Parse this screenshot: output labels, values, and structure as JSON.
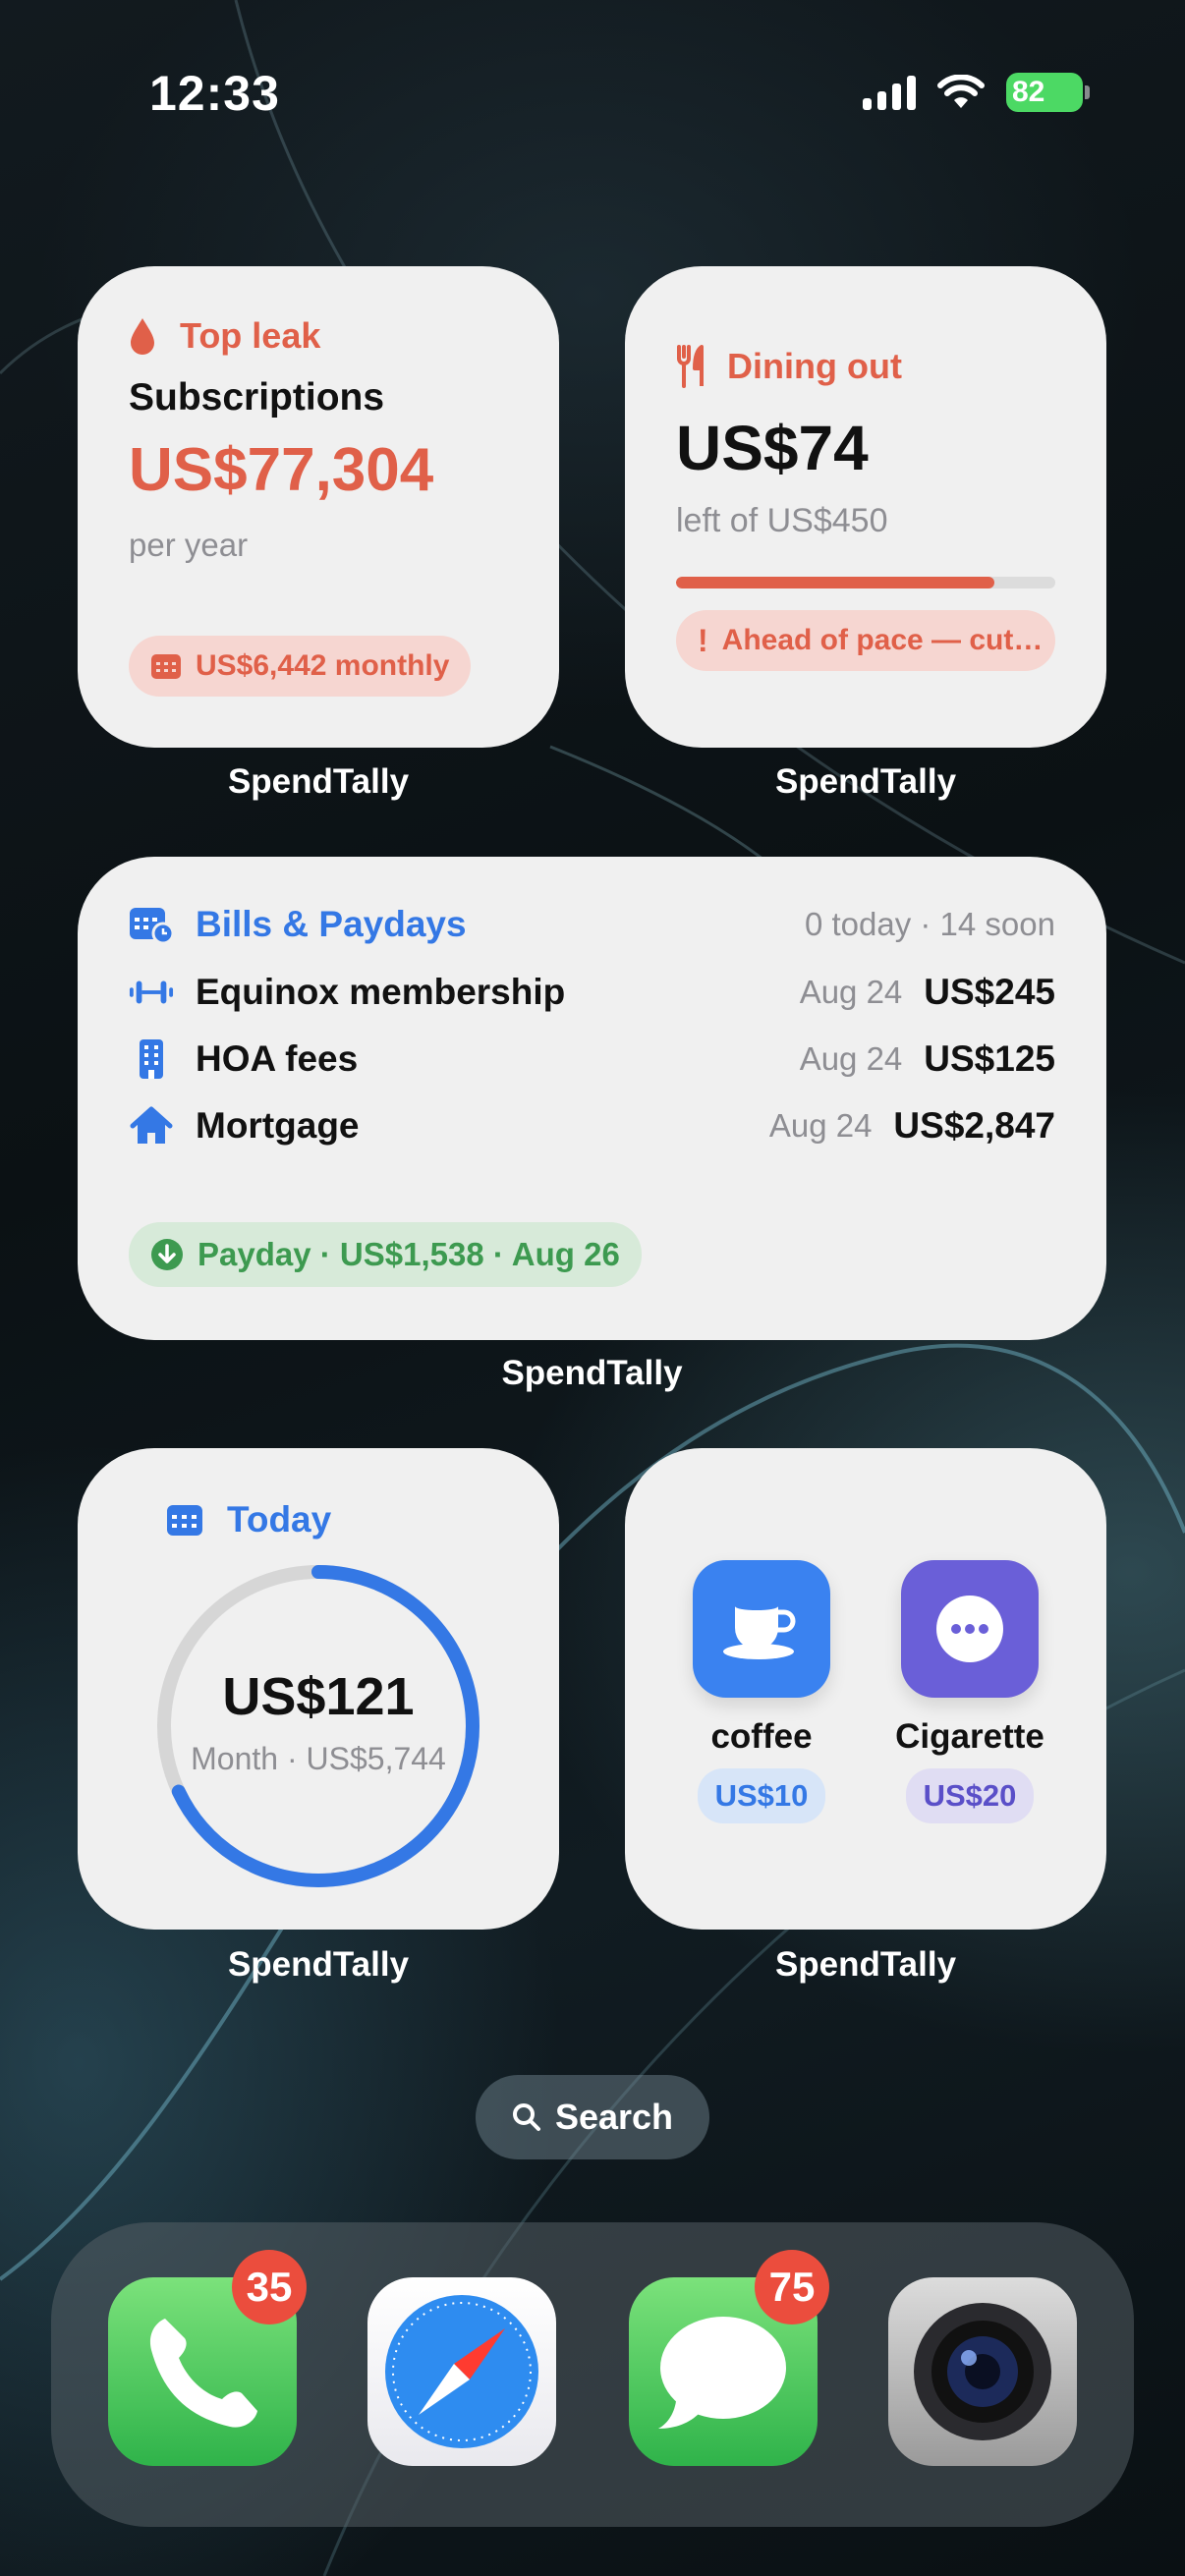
{
  "status_bar": {
    "time": "12:33",
    "battery": "82"
  },
  "widgets": {
    "top_leak": {
      "label": "Top leak",
      "category": "Subscriptions",
      "amount": "US$77,304",
      "period": "per year",
      "monthly": "US$6,442 monthly",
      "caption": "SpendTally",
      "accent": "#e06049"
    },
    "dining": {
      "label": "Dining out",
      "amount": "US$74",
      "remaining_text": "left of US$450",
      "progress": 0.84,
      "warning": "Ahead of pace — cut…",
      "caption": "SpendTally"
    },
    "bills": {
      "title": "Bills & Paydays",
      "summary": "0 today · 14 soon",
      "items": [
        {
          "name": "Equinox membership",
          "date": "Aug 24",
          "amount": "US$245",
          "icon": "dumbbell-icon"
        },
        {
          "name": "HOA fees",
          "date": "Aug 24",
          "amount": "US$125",
          "icon": "building-icon"
        },
        {
          "name": "Mortgage",
          "date": "Aug 24",
          "amount": "US$2,847",
          "icon": "house-icon"
        }
      ],
      "payday": "Payday · US$1,538 · Aug 26",
      "caption": "SpendTally"
    },
    "today": {
      "label": "Today",
      "amount": "US$121",
      "month": "Month · US$5,744",
      "progress": 0.68,
      "caption": "SpendTally"
    },
    "quick_add": {
      "items": [
        {
          "label": "coffee",
          "price": "US$10",
          "icon": "coffee-cup-icon",
          "color": "#3a82f0"
        },
        {
          "label": "Cigarette",
          "price": "US$20",
          "icon": "ellipsis-icon",
          "color": "#6a5fd8"
        }
      ],
      "caption": "SpendTally"
    }
  },
  "search": {
    "label": "Search"
  },
  "dock": {
    "apps": [
      {
        "name": "Phone",
        "badge": "35"
      },
      {
        "name": "Safari",
        "badge": ""
      },
      {
        "name": "Messages",
        "badge": "75"
      },
      {
        "name": "Camera",
        "badge": ""
      }
    ]
  }
}
